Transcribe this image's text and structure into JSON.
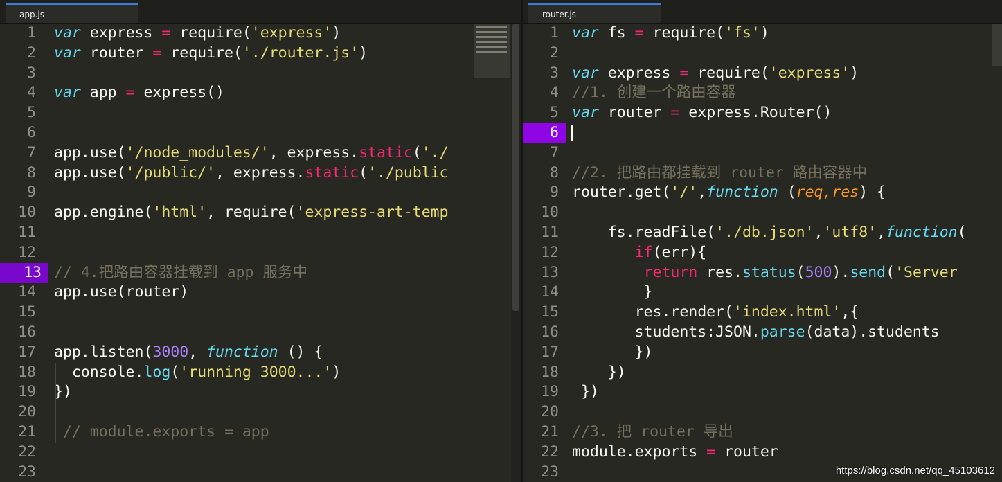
{
  "left": {
    "tab": "app.js",
    "lines": [
      {
        "n": "1",
        "t": [
          [
            "kw",
            "var"
          ],
          [
            "plain",
            " express "
          ],
          [
            "op",
            "="
          ],
          [
            "plain",
            " require("
          ],
          [
            "str",
            "'express'"
          ],
          [
            "plain",
            ")"
          ]
        ]
      },
      {
        "n": "2",
        "t": [
          [
            "kw",
            "var"
          ],
          [
            "plain",
            " router "
          ],
          [
            "op",
            "="
          ],
          [
            "plain",
            " require("
          ],
          [
            "str",
            "'./router.js'"
          ],
          [
            "plain",
            ")"
          ]
        ]
      },
      {
        "n": "3",
        "t": []
      },
      {
        "n": "4",
        "t": [
          [
            "kw",
            "var"
          ],
          [
            "plain",
            " app "
          ],
          [
            "op",
            "="
          ],
          [
            "plain",
            " express()"
          ]
        ]
      },
      {
        "n": "5",
        "t": []
      },
      {
        "n": "6",
        "t": []
      },
      {
        "n": "7",
        "t": [
          [
            "plain",
            "app.use("
          ],
          [
            "str",
            "'/node_modules/'"
          ],
          [
            "plain",
            ", express."
          ],
          [
            "op",
            "static"
          ],
          [
            "plain",
            "("
          ],
          [
            "str",
            "'./"
          ]
        ]
      },
      {
        "n": "8",
        "t": [
          [
            "plain",
            "app.use("
          ],
          [
            "str",
            "'/public/'"
          ],
          [
            "plain",
            ", express."
          ],
          [
            "op",
            "static"
          ],
          [
            "plain",
            "("
          ],
          [
            "str",
            "'./public"
          ]
        ]
      },
      {
        "n": "9",
        "t": []
      },
      {
        "n": "10",
        "t": [
          [
            "plain",
            "app.engine("
          ],
          [
            "str",
            "'html'"
          ],
          [
            "plain",
            ", require("
          ],
          [
            "str",
            "'express-art-temp"
          ]
        ]
      },
      {
        "n": "11",
        "t": []
      },
      {
        "n": "12",
        "t": []
      },
      {
        "n": "13",
        "t": [
          [
            "cm",
            "// 4.把路由容器挂载到 app 服务中"
          ]
        ],
        "active": true
      },
      {
        "n": "14",
        "t": [
          [
            "plain",
            "app.use(router)"
          ]
        ]
      },
      {
        "n": "15",
        "t": []
      },
      {
        "n": "16",
        "t": []
      },
      {
        "n": "17",
        "t": [
          [
            "plain",
            "app.listen("
          ],
          [
            "num",
            "3000"
          ],
          [
            "plain",
            ", "
          ],
          [
            "kw",
            "function"
          ],
          [
            "plain",
            " () {"
          ]
        ]
      },
      {
        "n": "18",
        "t": [
          [
            "plain",
            "  console."
          ],
          [
            "fn",
            "log"
          ],
          [
            "plain",
            "("
          ],
          [
            "str",
            "'running 3000...'"
          ],
          [
            "plain",
            ")"
          ]
        ]
      },
      {
        "n": "19",
        "t": [
          [
            "plain",
            "})"
          ]
        ]
      },
      {
        "n": "20",
        "t": []
      },
      {
        "n": "21",
        "t": [
          [
            "cm",
            " // module.exports = app"
          ]
        ]
      },
      {
        "n": "22",
        "t": []
      },
      {
        "n": "23",
        "t": []
      }
    ]
  },
  "right": {
    "tab": "router.js",
    "lines": [
      {
        "n": "1",
        "t": [
          [
            "kw",
            "var"
          ],
          [
            "plain",
            " fs "
          ],
          [
            "op",
            "="
          ],
          [
            "plain",
            " require("
          ],
          [
            "str",
            "'fs'"
          ],
          [
            "plain",
            ")"
          ]
        ]
      },
      {
        "n": "2",
        "t": []
      },
      {
        "n": "3",
        "t": [
          [
            "kw",
            "var"
          ],
          [
            "plain",
            " express "
          ],
          [
            "op",
            "="
          ],
          [
            "plain",
            " require("
          ],
          [
            "str",
            "'express'"
          ],
          [
            "plain",
            ")"
          ]
        ]
      },
      {
        "n": "4",
        "t": [
          [
            "cm",
            "//1. 创建一个路由容器"
          ]
        ]
      },
      {
        "n": "5",
        "t": [
          [
            "kw",
            "var"
          ],
          [
            "plain",
            " router "
          ],
          [
            "op",
            "="
          ],
          [
            "plain",
            " express.Router()"
          ]
        ]
      },
      {
        "n": "6",
        "t": [],
        "active": true
      },
      {
        "n": "7",
        "t": []
      },
      {
        "n": "8",
        "t": [
          [
            "cm",
            "//2. 把路由都挂载到 router 路由容器中"
          ]
        ]
      },
      {
        "n": "9",
        "t": [
          [
            "plain",
            "router.get("
          ],
          [
            "str",
            "'/'"
          ],
          [
            "plain",
            ","
          ],
          [
            "kw",
            "function"
          ],
          [
            "plain",
            " ("
          ],
          [
            "param",
            "req,res"
          ],
          [
            "plain",
            ") {"
          ]
        ]
      },
      {
        "n": "10",
        "t": []
      },
      {
        "n": "11",
        "t": [
          [
            "plain",
            "    fs.readFile("
          ],
          [
            "str",
            "'./db.json'"
          ],
          [
            "plain",
            ","
          ],
          [
            "str",
            "'utf8'"
          ],
          [
            "plain",
            ","
          ],
          [
            "kw",
            "function"
          ],
          [
            "plain",
            "("
          ]
        ]
      },
      {
        "n": "12",
        "t": [
          [
            "plain",
            "       "
          ],
          [
            "kwr",
            "if"
          ],
          [
            "plain",
            "(err){"
          ]
        ]
      },
      {
        "n": "13",
        "t": [
          [
            "plain",
            "        "
          ],
          [
            "kwr",
            "return"
          ],
          [
            "plain",
            " res."
          ],
          [
            "fn",
            "status"
          ],
          [
            "plain",
            "("
          ],
          [
            "num",
            "500"
          ],
          [
            "plain",
            ")."
          ],
          [
            "fn",
            "send"
          ],
          [
            "plain",
            "("
          ],
          [
            "str",
            "'Server"
          ]
        ]
      },
      {
        "n": "14",
        "t": [
          [
            "plain",
            "        }"
          ]
        ]
      },
      {
        "n": "15",
        "t": [
          [
            "plain",
            "       res.render("
          ],
          [
            "str",
            "'index.html'"
          ],
          [
            "plain",
            ",{"
          ]
        ]
      },
      {
        "n": "16",
        "t": [
          [
            "plain",
            "       students:JSON."
          ],
          [
            "fn",
            "parse"
          ],
          [
            "plain",
            "(data).students"
          ]
        ]
      },
      {
        "n": "17",
        "t": [
          [
            "plain",
            "       })"
          ]
        ]
      },
      {
        "n": "18",
        "t": [
          [
            "plain",
            "    })"
          ]
        ]
      },
      {
        "n": "19",
        "t": [
          [
            "plain",
            " })"
          ]
        ]
      },
      {
        "n": "20",
        "t": []
      },
      {
        "n": "21",
        "t": [
          [
            "cm",
            "//3. 把 router 导出"
          ]
        ]
      },
      {
        "n": "22",
        "t": [
          [
            "plain",
            "module.exports "
          ],
          [
            "op",
            "="
          ],
          [
            "plain",
            " router"
          ]
        ]
      },
      {
        "n": "23",
        "t": []
      }
    ]
  },
  "watermark": "https://blog.csdn.net/qq_45103612"
}
